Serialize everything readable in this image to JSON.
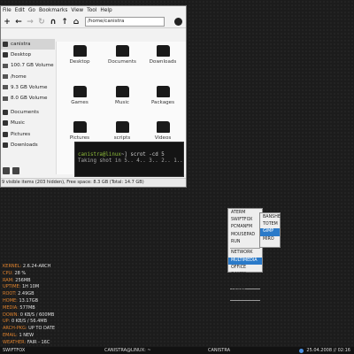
{
  "file_manager": {
    "menu": [
      "File",
      "Edit",
      "Go",
      "Bookmarks",
      "View",
      "Tool",
      "Help"
    ],
    "toolbar_icons": [
      "new-icon",
      "back-icon",
      "forward-icon",
      "reload-icon",
      "spatial-icon",
      "up-icon",
      "home-icon"
    ],
    "location": "/home/canistra",
    "sidebar": [
      {
        "label": "canistra",
        "icon": "home-icon",
        "selected": true
      },
      {
        "label": "Desktop",
        "icon": "desktop-icon"
      },
      {
        "label": "100.7 GB Volume",
        "icon": "drive-icon"
      },
      {
        "label": "/home",
        "icon": "drive-icon"
      },
      {
        "label": "9.3 GB Volume",
        "icon": "drive-icon"
      },
      {
        "label": "8.0 GB Volume",
        "icon": "drive-icon"
      },
      {
        "label": "Documents",
        "icon": "folder-icon"
      },
      {
        "label": "Music",
        "icon": "folder-icon"
      },
      {
        "label": "Pictures",
        "icon": "folder-icon"
      },
      {
        "label": "Downloads",
        "icon": "folder-icon"
      }
    ],
    "folders": [
      "Desktop",
      "Documents",
      "Downloads",
      "Games",
      "Music",
      "Packages",
      "Pictures",
      "scripts",
      "Videos"
    ],
    "status": "9 visible items (203 hidden), Free space: 8.3 GB (Total: 14.7 GB)"
  },
  "terminal": {
    "prompt": "canistra@linux",
    "command": "~] scrot -cd 5",
    "output": "Taking shot in 5.. 4.. 3.. 2.. 1.. "
  },
  "context_menu": {
    "items": [
      "ATERM",
      "SWIFTFOX",
      "PCMANFM",
      "MOUSEPAD",
      "RUN",
      "---",
      "NETWORK",
      "MULTIMEDIA",
      "OFFICE",
      "GAMES",
      "SYSTEM TOOLS",
      "---",
      "OPENBOX",
      "---",
      "SHUTDOWN"
    ],
    "active": "MULTIMEDIA",
    "submenu": [
      "BANSHEE",
      "TOTEM",
      "GIMP",
      "MIRO"
    ],
    "submenu_active": "GIMP",
    "accent_color": "#2a7ac9"
  },
  "conky": [
    {
      "key": "KERNEL",
      "value": "2.6.24-ARCH"
    },
    {
      "key": "CPU",
      "value": "28 %"
    },
    {
      "key": "RAM",
      "value": "256MB"
    },
    {
      "key": "UPTIME",
      "value": "1H 10M"
    },
    {
      "key": "ROOT",
      "value": "2.49GB"
    },
    {
      "key": "HOME",
      "value": "13.17GB"
    },
    {
      "key": "MEDIA",
      "value": "577MB"
    },
    {
      "key": "DOWN",
      "value": "0 KB/S / 600MB"
    },
    {
      "key": "UP",
      "value": "0 KB/S / 56.4MB"
    },
    {
      "key": "ARCH-PKG",
      "value": "UP TO DATE"
    },
    {
      "key": "EMAIL",
      "value": "1 NEW"
    },
    {
      "key": "WEATHER",
      "value": "FAIR - 16C"
    }
  ],
  "taskbar": {
    "left": "SWIFTFOX",
    "center1": "CANISTRA@LINUX: ~",
    "center2": "CANISTRA",
    "datetime": "25.04.2008 // 02:16"
  }
}
